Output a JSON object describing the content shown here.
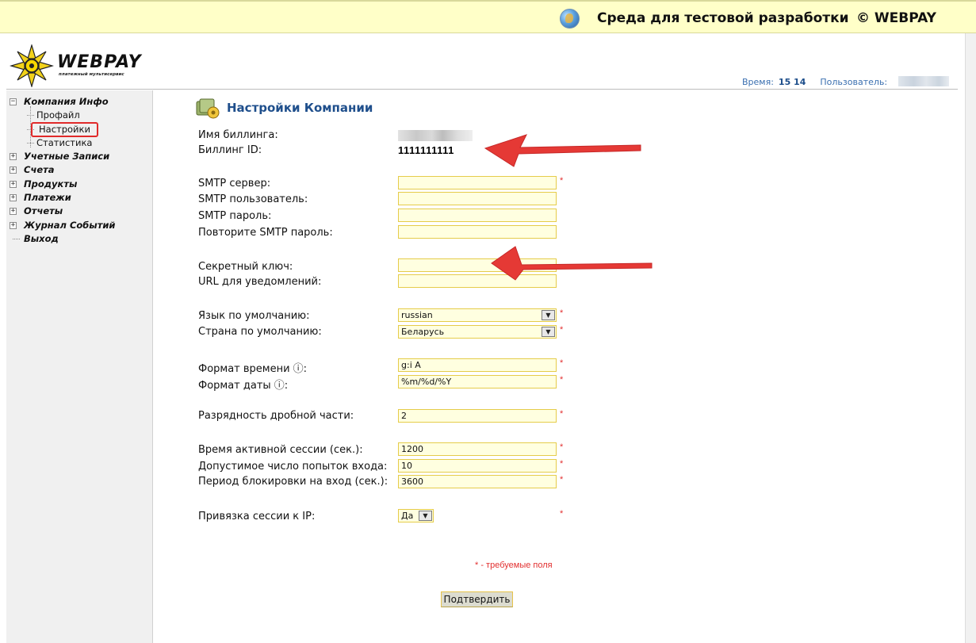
{
  "topbar": {
    "title": "Среда для тестовой разработки",
    "copyright": "© WEBPAY"
  },
  "logo": {
    "name": "WEBPAY",
    "tagline": "платежный мультисервис"
  },
  "header_info": {
    "time_label": "Время:",
    "time_value": "15 14",
    "user_label": "Пользователь:"
  },
  "sidebar": {
    "company": "Компания Инфо",
    "profile": "Профайл",
    "settings": "Настройки",
    "statistics": "Статистика",
    "accounts": "Учетные Записи",
    "invoices": "Счета",
    "products": "Продукты",
    "payments": "Платежи",
    "reports": "Отчеты",
    "event_log": "Журнал Событий",
    "logout": "Выход"
  },
  "page": {
    "title": "Настройки Компании"
  },
  "form": {
    "billing_name_label": "Имя биллинга:",
    "billing_id_label": "Биллинг ID:",
    "billing_id_value": "1111111111",
    "smtp_server_label": "SMTP сервер:",
    "smtp_user_label": "SMTP пользователь:",
    "smtp_password_label": "SMTP пароль:",
    "smtp_password_repeat_label": "Повторите SMTP пароль:",
    "secret_key_label": "Секретный ключ:",
    "notify_url_label": "URL для уведомлений:",
    "language_label": "Язык по умолчанию:",
    "language_value": "russian",
    "country_label": "Страна по умолчанию:",
    "country_value": "Беларусь",
    "time_format_label": "Формат времени ⓘ:",
    "time_format_value": "g:i A",
    "date_format_label": "Формат даты ⓘ:",
    "date_format_value": "%m/%d/%Y",
    "decimal_label": "Разрядность дробной части:",
    "decimal_value": "2",
    "session_time_label": "Время активной сессии (сек.):",
    "session_time_value": "1200",
    "login_attempts_label": "Допустимое число попыток входа:",
    "login_attempts_value": "10",
    "lock_period_label": "Период блокировки на вход (сек.):",
    "lock_period_value": "3600",
    "ip_bind_label": "Привязка сессии к IP:",
    "ip_bind_value": "Да",
    "required_mark": "*",
    "required_note": "* - требуемые поля",
    "submit_label": "Подтвердить"
  },
  "colors": {
    "topbar_bg": "#ffffc8",
    "input_bg": "#ffffe0",
    "input_border": "#e5cc4a",
    "title_blue": "#1f4f8c",
    "required_red": "#e23030",
    "annotation_red": "#e53935"
  }
}
